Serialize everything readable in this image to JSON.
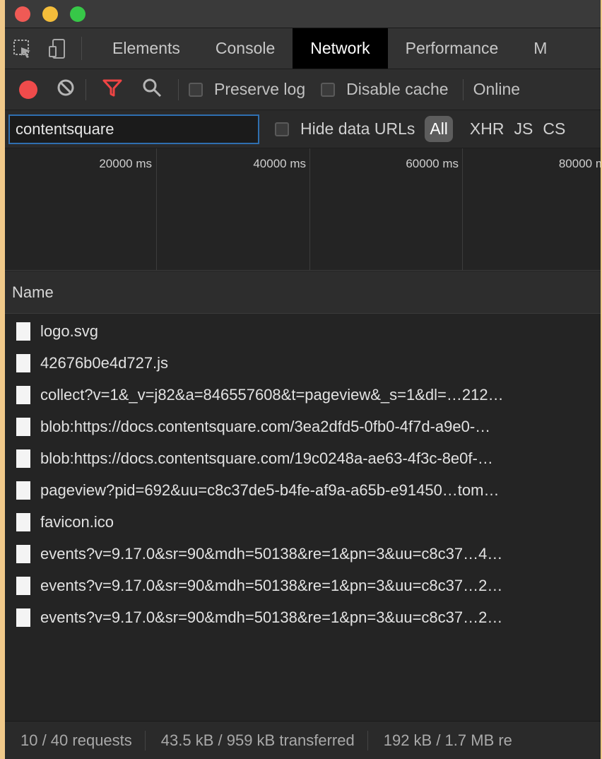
{
  "devtools": {
    "tabs": [
      "Elements",
      "Console",
      "Network",
      "Performance",
      "M"
    ],
    "active_tab": "Network"
  },
  "toolbar": {
    "preserve_log_label": "Preserve log",
    "disable_cache_label": "Disable cache",
    "throttling_value": "Online"
  },
  "filter": {
    "value": "contentsquare",
    "hide_data_urls_label": "Hide data URLs",
    "types": [
      "All",
      "XHR",
      "JS",
      "CS"
    ]
  },
  "overview": {
    "ticks": [
      "20000 ms",
      "40000 ms",
      "60000 ms",
      "80000 m"
    ]
  },
  "table": {
    "column_name": "Name",
    "rows": [
      "logo.svg",
      "42676b0e4d727.js",
      "collect?v=1&_v=j82&a=846557608&t=pageview&_s=1&dl=…212…",
      "blob:https://docs.contentsquare.com/3ea2dfd5-0fb0-4f7d-a9e0-…",
      "blob:https://docs.contentsquare.com/19c0248a-ae63-4f3c-8e0f-…",
      "pageview?pid=692&uu=c8c37de5-b4fe-af9a-a65b-e91450…tom…",
      "favicon.ico",
      "events?v=9.17.0&sr=90&mdh=50138&re=1&pn=3&uu=c8c37…4…",
      "events?v=9.17.0&sr=90&mdh=50138&re=1&pn=3&uu=c8c37…2…",
      "events?v=9.17.0&sr=90&mdh=50138&re=1&pn=3&uu=c8c37…2…"
    ]
  },
  "status": {
    "requests": "10 / 40 requests",
    "transferred": "43.5 kB / 959 kB transferred",
    "resources": "192 kB / 1.7 MB re"
  },
  "colors": {
    "record": "#ef4b4b",
    "filter_icon": "#ef4444",
    "active_tab_bg": "#000000",
    "input_border": "#2f6fb0"
  },
  "icons": {
    "inspect": "element-picker-icon",
    "device": "device-toggle-icon",
    "clear": "clear-icon",
    "filter": "filter-icon",
    "search": "search-icon",
    "file": "file-icon"
  }
}
